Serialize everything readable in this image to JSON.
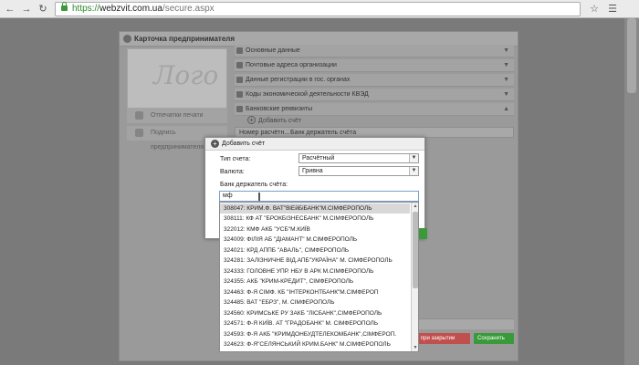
{
  "browser": {
    "url_scheme": "https://",
    "url_host": "webzvit.com.ua",
    "url_path": "/secure.aspx"
  },
  "card": {
    "title": "Карточка предпринимателя",
    "logo_text": "Лого",
    "left_links": [
      "Отпечатки печати организации",
      "Подпись предпринимателя"
    ],
    "sections": [
      "Основные данные",
      "Почтовые адреса организации",
      "Данные регистрации в гос. органах",
      "Коды экономической деятельности КВЭД",
      "Банковские реквизиты"
    ],
    "add_account": "Добавить счёт",
    "tab_headers": [
      "Номер расчётн...",
      "Банк держатель счёта"
    ],
    "footer_buttons": [
      "...ить при закрытии",
      "Сохранить"
    ]
  },
  "dialog": {
    "title": "Добавить счёт",
    "account_type_label": "Тип счета:",
    "account_type_value": "Расчётный",
    "currency_label": "Валюта:",
    "currency_value": "Гривна",
    "bank_label": "Банк держатель счёта:",
    "bank_input_value": "мф",
    "options": [
      "308047: КРИМ.Ф. ВАТ\"ВіЕйБіБАНК\"М.СІМФЕРОПОЛЬ",
      "308111: КФ АТ \"БРОКБІЗНЕСБАНК\" М.СІМФЕРОПОЛЬ",
      "322012: КМФ АКБ \"УСБ\"М.КИЇВ",
      "324009: ФІЛІЯ АБ \"ДІАМАНТ\" М.СІМФЕРОПОЛЬ",
      "324021: КРД АППБ \"АВАЛЬ\", СІМФЕРОПОЛЬ",
      "324281: ЗАЛІЗНИЧНЕ ВІД.АПБ\"УКРАЇНА\" М. СІМФЕРОПОЛЬ",
      "324333: ГОЛОВНЕ УПР. НБУ В АРК М.СІМФЕРОПОЛЬ",
      "324355: АКБ \"КРИМ-КРЕДИТ\", СІМФЕРОПОЛЬ",
      "324463: Ф-Я СІМФ. КБ \"ІНТЕРКОНТБАНК\"М.СІМФЕРОП",
      "324485: ВАТ \"ЕБРЗ\", М. СІМФЕРОПОЛЬ",
      "324560: КРИМСЬКЕ РУ ЗАКБ \"ЛІСБАНК\",СІМФЕРОПОЛЬ",
      "324571: Ф-Я КИЇВ. АТ \"ГРАДОБАНК\" М. СІМФЕРОПОЛЬ",
      "324593: Ф-Я АКБ \"КРИМДОНБУДТЕЛЕКОМБАНК\",СІМФЕРОП.",
      "324623: Ф-Я\"СЕЛЯНСЬКИЙ КРИМ.БАНК\" М.СІМФЕРОПОЛЬ"
    ]
  },
  "colors": {
    "save_button": "#3a9a3a",
    "close_button": "#c0504d",
    "highlight_row": "#d8d8d8"
  }
}
